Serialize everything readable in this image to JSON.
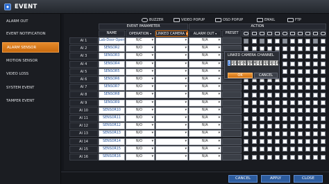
{
  "window": {
    "title": "EVENT"
  },
  "sidebar": {
    "items": [
      {
        "label": "ALARM OUT",
        "active": false
      },
      {
        "label": "EVENT NOTIFICATION",
        "active": false
      },
      {
        "label": "ALARM SENSOR",
        "active": true
      },
      {
        "label": "MOTION SENSOR",
        "active": false
      },
      {
        "label": "VIDEO LOSS",
        "active": false
      },
      {
        "label": "SYSTEM EVENT",
        "active": false
      },
      {
        "label": "TAMPER EVENT",
        "active": false
      }
    ]
  },
  "toolbar": {
    "buzzer": "BUZZER",
    "video_popup": "VIDEO POPUP",
    "osd_popup": "OSD POPUP",
    "email": "EMAIL",
    "ftp": "FTP"
  },
  "table": {
    "group_event_parameter": "EVENT PARAMETER",
    "group_action": "ACTION",
    "col_name": "NAME",
    "col_operation": "OPERATION",
    "col_linked_camera": "LINKED CAMERA",
    "col_alarm_out": "ALARM OUT",
    "col_preset": "PRESET",
    "rows": [
      {
        "label": "AI 1",
        "name": "Lab-Door-Open",
        "operation": "N/C",
        "alarm_out": "N/A",
        "checks": [
          1,
          0,
          1,
          0,
          0,
          1,
          0,
          0,
          0,
          1,
          0
        ]
      },
      {
        "label": "AI 2",
        "name": "SENSOR2",
        "operation": "N/O",
        "alarm_out": "N/A",
        "checks": [
          0,
          0,
          0,
          0,
          0,
          0,
          0,
          0,
          0,
          0,
          0
        ]
      },
      {
        "label": "AI 3",
        "name": "SENSOR3",
        "operation": "N/O",
        "alarm_out": "N/A",
        "checks": [
          0,
          0,
          0,
          0,
          0,
          0,
          0,
          0,
          0,
          0,
          0
        ]
      },
      {
        "label": "AI 4",
        "name": "SENSOR4",
        "operation": "N/O",
        "alarm_out": "N/A",
        "checks": [
          0,
          0,
          0,
          0,
          0,
          0,
          0,
          0,
          0,
          0,
          0
        ]
      },
      {
        "label": "AI 5",
        "name": "SENSOR5",
        "operation": "N/O",
        "alarm_out": "N/A",
        "checks": [
          0,
          0,
          0,
          0,
          0,
          0,
          0,
          0,
          0,
          0,
          0
        ]
      },
      {
        "label": "AI 6",
        "name": "SENSOR6",
        "operation": "N/O",
        "alarm_out": "N/A",
        "checks": [
          0,
          0,
          0,
          0,
          0,
          0,
          0,
          0,
          0,
          0,
          0
        ]
      },
      {
        "label": "AI 7",
        "name": "SENSOR7",
        "operation": "N/O",
        "alarm_out": "N/A",
        "checks": [
          0,
          0,
          0,
          0,
          0,
          0,
          0,
          0,
          0,
          0,
          0
        ]
      },
      {
        "label": "AI 8",
        "name": "SENSOR8",
        "operation": "N/O",
        "alarm_out": "N/A",
        "checks": [
          0,
          0,
          0,
          0,
          0,
          0,
          0,
          0,
          0,
          0,
          0
        ]
      },
      {
        "label": "AI 9",
        "name": "SENSOR9",
        "operation": "N/O",
        "alarm_out": "N/A",
        "checks": [
          0,
          0,
          0,
          0,
          0,
          0,
          0,
          0,
          0,
          0,
          0
        ]
      },
      {
        "label": "AI 10",
        "name": "SENSOR10",
        "operation": "N/O",
        "alarm_out": "N/A",
        "checks": [
          0,
          0,
          0,
          0,
          0,
          0,
          0,
          0,
          0,
          0,
          0
        ]
      },
      {
        "label": "AI 11",
        "name": "SENSOR11",
        "operation": "N/O",
        "alarm_out": "N/A",
        "checks": [
          0,
          0,
          0,
          0,
          0,
          0,
          0,
          0,
          0,
          0,
          0
        ]
      },
      {
        "label": "AI 12",
        "name": "SENSOR12",
        "operation": "N/O",
        "alarm_out": "N/A",
        "checks": [
          0,
          0,
          0,
          0,
          0,
          0,
          0,
          0,
          0,
          0,
          0
        ]
      },
      {
        "label": "AI 13",
        "name": "SENSOR13",
        "operation": "N/O",
        "alarm_out": "N/A",
        "checks": [
          0,
          0,
          0,
          0,
          0,
          0,
          0,
          0,
          0,
          0,
          0
        ]
      },
      {
        "label": "AI 14",
        "name": "SENSOR14",
        "operation": "N/O",
        "alarm_out": "N/A",
        "checks": [
          0,
          0,
          0,
          0,
          0,
          0,
          0,
          0,
          0,
          0,
          0
        ]
      },
      {
        "label": "AI 15",
        "name": "SENSOR15",
        "operation": "N/O",
        "alarm_out": "N/A",
        "checks": [
          0,
          0,
          0,
          0,
          0,
          0,
          0,
          0,
          0,
          0,
          0
        ]
      },
      {
        "label": "AI 16",
        "name": "SENSOR16",
        "operation": "N/O",
        "alarm_out": "N/A",
        "checks": [
          0,
          0,
          0,
          0,
          0,
          0,
          0,
          0,
          0,
          0,
          0
        ]
      }
    ]
  },
  "popup": {
    "title": "LINKED CAMERA CHANNEL",
    "channels": [
      "1",
      "2",
      "3",
      "4",
      "5",
      "6",
      "7",
      "8",
      "9",
      "10",
      "11",
      "12",
      "13",
      "14",
      "15",
      "16"
    ],
    "selected": [
      "1"
    ],
    "ok_label": "OK",
    "cancel_label": "CANCEL"
  },
  "footer": {
    "cancel_label": "CANCEL",
    "apply_label": "APPLY",
    "close_label": "CLOSE"
  },
  "colors": {
    "accent": "#e07b1f",
    "button_blue": "#2d5c9e",
    "header_bg": "#252830"
  }
}
